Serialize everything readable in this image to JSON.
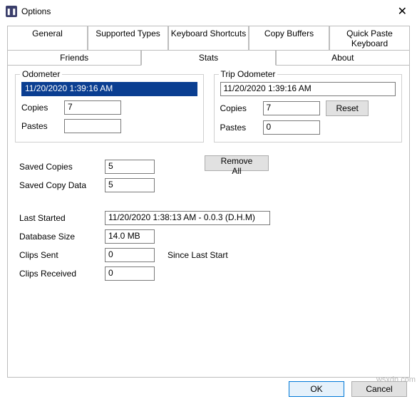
{
  "window": {
    "title": "Options",
    "close": "✕"
  },
  "tabs_row1": [
    "General",
    "Supported Types",
    "Keyboard Shortcuts",
    "Copy Buffers",
    "Quick Paste Keyboard"
  ],
  "tabs_row2": [
    "Friends",
    "Stats",
    "About"
  ],
  "odometer": {
    "title": "Odometer",
    "date": "11/20/2020 1:39:16 AM",
    "copies_label": "Copies",
    "copies_val": "7",
    "pastes_label": "Pastes",
    "pastes_val": ""
  },
  "trip": {
    "title": "Trip Odometer",
    "date": "11/20/2020 1:39:16 AM",
    "copies_label": "Copies",
    "copies_val": "7",
    "pastes_label": "Pastes",
    "pastes_val": "0",
    "reset": "Reset"
  },
  "saved": {
    "copies_label": "Saved Copies",
    "copies_val": "5",
    "data_label": "Saved Copy Data",
    "data_val": "5",
    "remove": "Remove All"
  },
  "info": {
    "last_started_label": "Last Started",
    "last_started_val": "11/20/2020 1:38:13 AM  -  0.0.3 (D.H.M)",
    "db_label": "Database Size",
    "db_val": "14.0 MB",
    "sent_label": "Clips Sent",
    "sent_val": "0",
    "recv_label": "Clips Received",
    "recv_val": "0",
    "since": "Since Last Start"
  },
  "footer": {
    "ok": "OK",
    "cancel": "Cancel"
  },
  "watermark": "wsxdn.com"
}
